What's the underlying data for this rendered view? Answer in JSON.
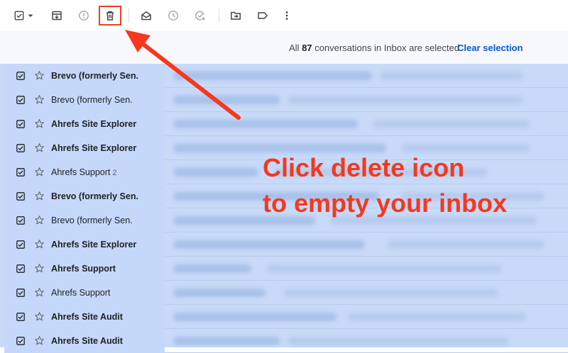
{
  "toolbar": {
    "icons": [
      "select-checkbox-icon",
      "archive-icon",
      "report-spam-icon",
      "delete-icon",
      "mark-read-icon",
      "snooze-icon",
      "add-to-tasks-icon",
      "move-to-icon",
      "label-icon",
      "more-icon"
    ]
  },
  "banner": {
    "prefix": "All ",
    "count": "87",
    "suffix": " conversations in Inbox are selected.",
    "clear_label": "Clear selection"
  },
  "emails": [
    {
      "sender": "Brevo (formerly Sen.",
      "count": "",
      "bold": true
    },
    {
      "sender": "Brevo (formerly Sen.",
      "count": "",
      "bold": false
    },
    {
      "sender": "Ahrefs Site Explorer",
      "count": "",
      "bold": true
    },
    {
      "sender": "Ahrefs Site Explorer",
      "count": "",
      "bold": true
    },
    {
      "sender": "Ahrefs Support",
      "count": "2",
      "bold": false
    },
    {
      "sender": "Brevo (formerly Sen.",
      "count": "",
      "bold": true
    },
    {
      "sender": "Brevo (formerly Sen.",
      "count": "",
      "bold": false
    },
    {
      "sender": "Ahrefs Site Explorer",
      "count": "",
      "bold": true
    },
    {
      "sender": "Ahrefs Support",
      "count": "",
      "bold": true
    },
    {
      "sender": "Ahrefs Support",
      "count": "",
      "bold": false
    },
    {
      "sender": "Ahrefs Site Audit",
      "count": "",
      "bold": true
    },
    {
      "sender": "Ahrefs Site Audit",
      "count": "",
      "bold": true
    }
  ],
  "annotation": {
    "line1": "Click delete icon",
    "line2": "to empty your inbox",
    "color": "#f5381e"
  },
  "colors": {
    "selected_row": "#c5d8fa",
    "link": "#0b57d0",
    "highlight_box": "#e8402a"
  }
}
